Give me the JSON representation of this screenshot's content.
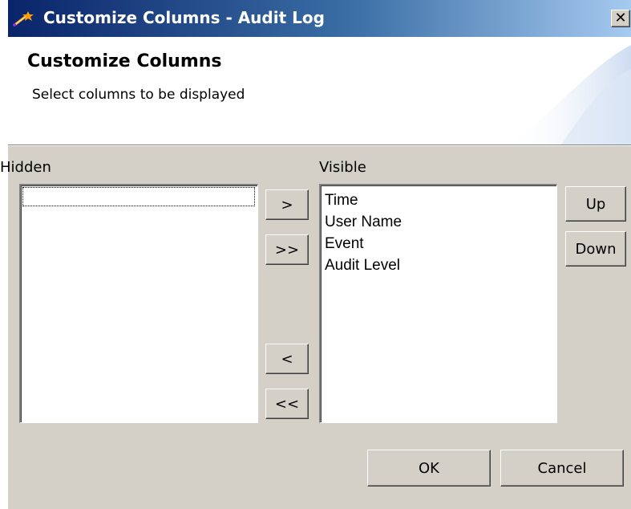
{
  "window": {
    "title": "Customize Columns  - Audit Log",
    "close_label": "✕",
    "icon": "wand-icon"
  },
  "banner": {
    "title": "Customize Columns",
    "subtitle": "Select columns to be displayed"
  },
  "hidden_list": {
    "label": "Hidden",
    "items": []
  },
  "visible_list": {
    "label": "Visible",
    "items": [
      "Time",
      "User Name",
      "Event",
      "Audit Level"
    ]
  },
  "transfer_buttons": {
    "add": ">",
    "add_all": ">>",
    "remove": "<",
    "remove_all": "<<"
  },
  "order_buttons": {
    "up": "Up",
    "down": "Down"
  },
  "footer": {
    "ok": "OK",
    "cancel": "Cancel"
  },
  "colors": {
    "titlebar_start": "#0a246a",
    "titlebar_end": "#a6caf0",
    "dialog_bg": "#d4d0c8"
  }
}
